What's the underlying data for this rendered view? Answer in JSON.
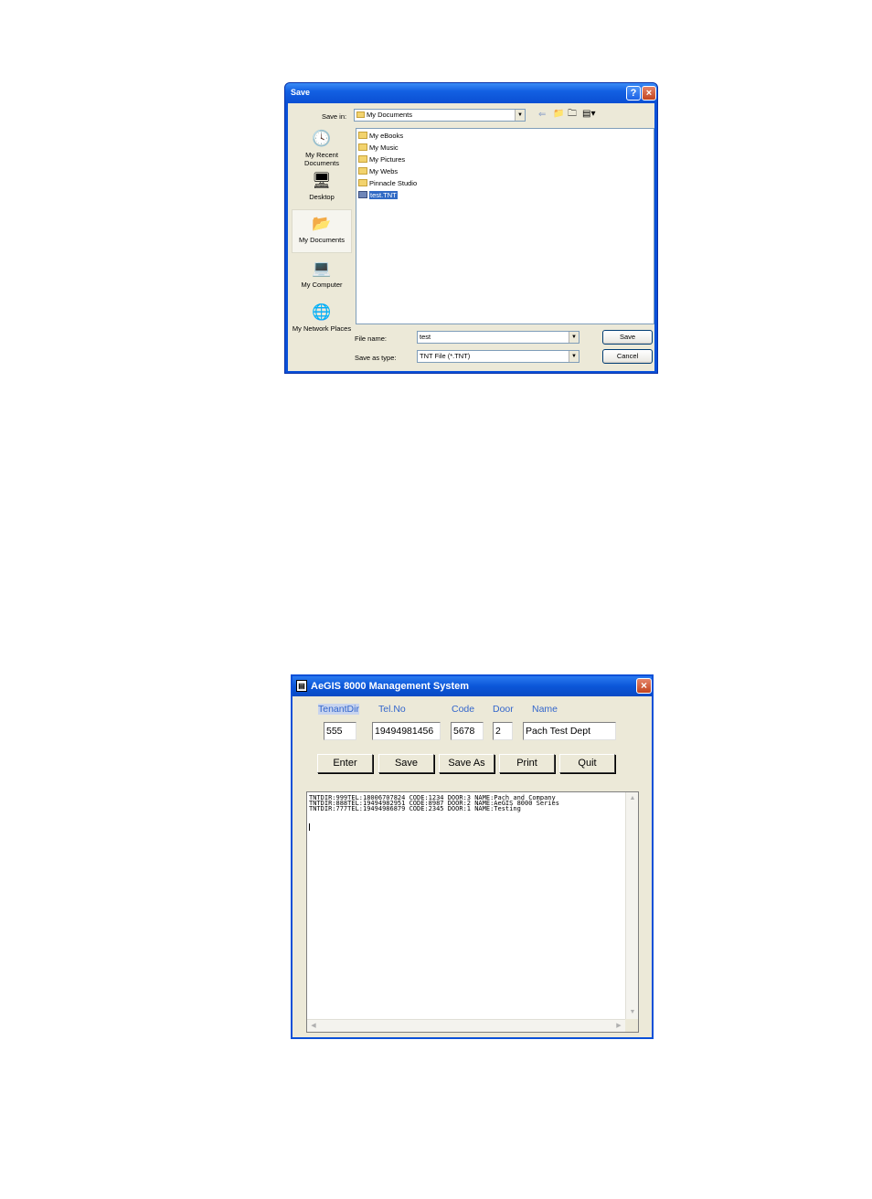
{
  "save_dialog": {
    "title": "Save",
    "save_in_label": "Save in:",
    "save_in_value": "My Documents",
    "places": [
      {
        "label": "My Recent Documents",
        "icon": "recent-documents-icon"
      },
      {
        "label": "Desktop",
        "icon": "desktop-icon"
      },
      {
        "label": "My Documents",
        "icon": "my-documents-icon",
        "selected": true
      },
      {
        "label": "My Computer",
        "icon": "my-computer-icon"
      },
      {
        "label": "My Network Places",
        "icon": "network-places-icon"
      }
    ],
    "files": [
      {
        "name": "My eBooks",
        "type": "folder"
      },
      {
        "name": "My Music",
        "type": "folder"
      },
      {
        "name": "My Pictures",
        "type": "folder"
      },
      {
        "name": "My Webs",
        "type": "folder"
      },
      {
        "name": "Pinnacle Studio",
        "type": "folder"
      },
      {
        "name": "test.TNT",
        "type": "file",
        "selected": true
      }
    ],
    "file_name_label": "File name:",
    "file_name_value": "test",
    "save_as_type_label": "Save as type:",
    "save_as_type_value": "TNT File (*.TNT)",
    "save_button": "Save",
    "cancel_button": "Cancel"
  },
  "aegis": {
    "title": "AeGIS 8000 Management System",
    "columns": {
      "tenant_dir": "TenantDir",
      "tel_no": "Tel.No",
      "code": "Code",
      "door": "Door",
      "name": "Name"
    },
    "fields": {
      "tenant_dir": "555",
      "tel_no": "19494981456",
      "code": "5678",
      "door": "2",
      "name": "Pach Test Dept"
    },
    "buttons": {
      "enter": "Enter",
      "save": "Save",
      "save_as": "Save As",
      "print": "Print",
      "quit": "Quit"
    },
    "log_lines": [
      "TNTDIR:999TEL:18006707824 CODE:1234 DOOR:3 NAME:Pach and Company",
      "TNTDIR:888TEL:19494982951 CODE:8987 DOOR:2 NAME:AeGIS 8000 Series",
      "TNTDIR:777TEL:19494986879 CODE:2345 DOOR:1 NAME:Testing"
    ]
  }
}
